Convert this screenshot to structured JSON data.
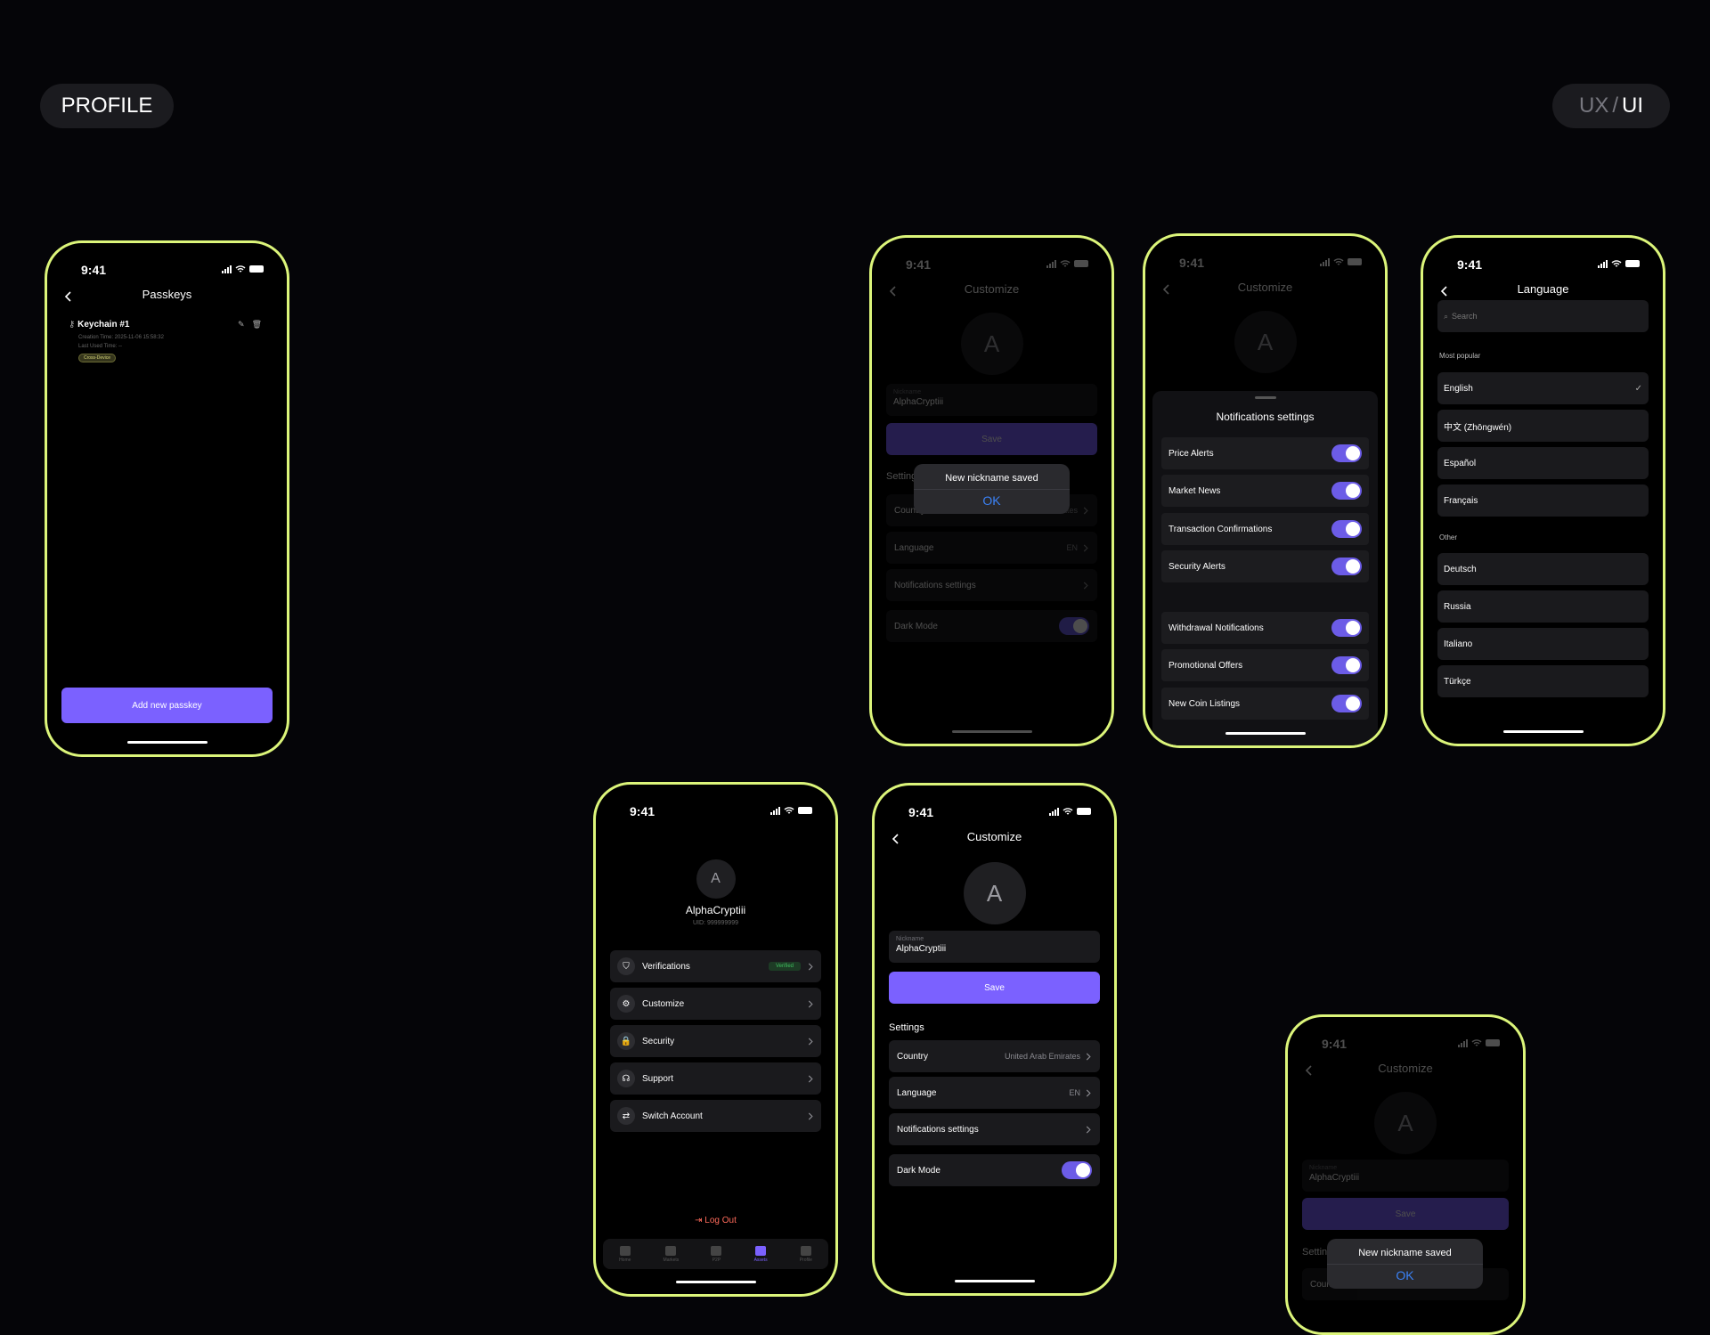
{
  "pills": {
    "left": "PROFILE",
    "right_ux": "UX",
    "right_slash": "/",
    "right_ui": "UI"
  },
  "status_time": "9:41",
  "passkeys": {
    "title": "Passkeys",
    "item_name": "Keychain #1",
    "creation": "Creation Time: 2025-11-06 15:58:32",
    "last_used": "Last Used Time: --",
    "badge": "Cross-Device",
    "add_button": "Add new passkey"
  },
  "customize": {
    "title": "Customize",
    "avatar_letter": "A",
    "nickname_label": "Nickname",
    "nickname_value": "AlphaCryptiii",
    "save_label": "Save",
    "settings_label": "Settings",
    "rows": [
      {
        "label": "Country",
        "value": "United Arab Emirates"
      },
      {
        "label": "Language",
        "value": "EN"
      },
      {
        "label": "Notifications settings",
        "value": ""
      }
    ],
    "dark_mode": "Dark Mode"
  },
  "dialog": {
    "text": "New nickname saved",
    "ok": "OK"
  },
  "notifications": {
    "title": "Notifications settings",
    "group1": [
      "Price Alerts",
      "Market News",
      "Transaction Confirmations",
      "Security Alerts"
    ],
    "group2": [
      "Withdrawal Notifications",
      "Promotional Offers",
      "New Coin Listings"
    ]
  },
  "language": {
    "title": "Language",
    "search_placeholder": "Search",
    "popular_label": "Most popular",
    "popular": [
      "English",
      "中文 (Zhōngwén)",
      "Español",
      "Français"
    ],
    "other_label": "Other",
    "other": [
      "Deutsch",
      "Russia",
      "Italiano",
      "Türkçe"
    ]
  },
  "profile": {
    "avatar_letter": "A",
    "name": "AlphaCryptiii",
    "uid": "UID: 999999999",
    "menu": [
      {
        "label": "Verifications",
        "icon": "shield-icon"
      },
      {
        "label": "Customize",
        "icon": "gear-icon"
      },
      {
        "label": "Security",
        "icon": "lock-icon"
      },
      {
        "label": "Support",
        "icon": "headset-icon"
      },
      {
        "label": "Switch Account",
        "icon": "switch-account-icon"
      }
    ],
    "verified_badge": "Verified",
    "logout": "Log Out",
    "tabs": [
      "Home",
      "Markets",
      "P2P",
      "Assets",
      "Profile"
    ],
    "active_tab": "Assets"
  }
}
